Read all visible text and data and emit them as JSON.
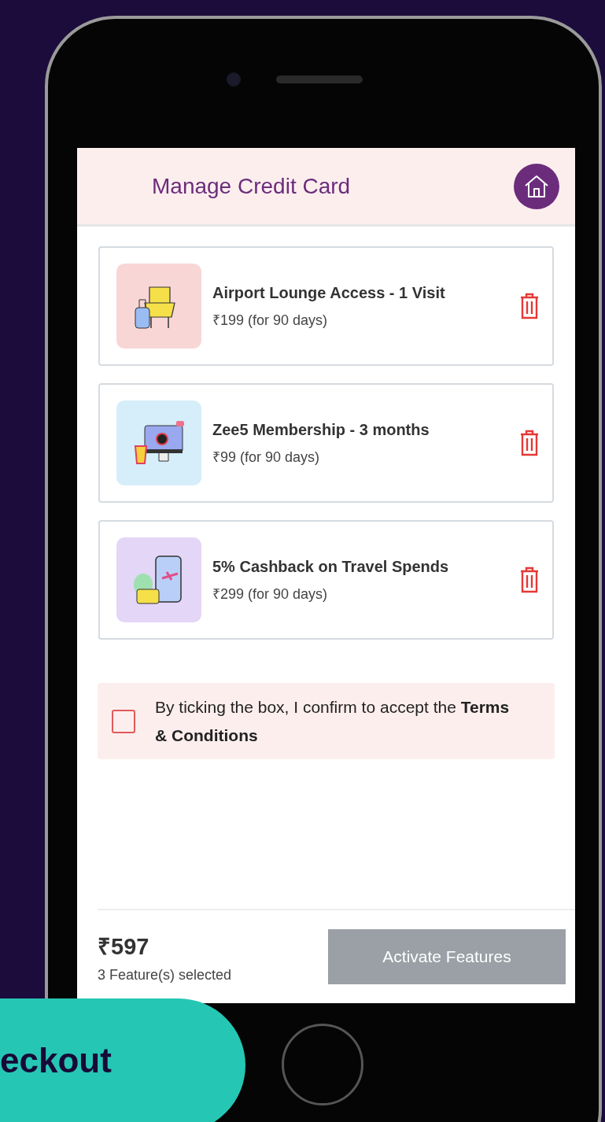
{
  "screen": {
    "title": "Manage Credit Card",
    "features": [
      {
        "kind": "lounge",
        "name": "Airport Lounge Access - 1 Visit",
        "price": "₹199 (for 90 days)"
      },
      {
        "kind": "tv",
        "name": "Zee5 Membership - 3 months",
        "price": "₹99 (for 90 days)"
      },
      {
        "kind": "travel",
        "name": "5% Cashback on Travel Spends",
        "price": "₹299 (for 90 days)"
      }
    ],
    "terms": {
      "checked": false,
      "text": "By ticking the box, I confirm to accept the **Terms & Conditions**"
    },
    "footer": {
      "total": "₹597",
      "count": "3 Feature(s) selected",
      "button": {
        "label": "Activate Features",
        "disabled": true
      }
    }
  },
  "banner": {
    "text": "eckout"
  }
}
